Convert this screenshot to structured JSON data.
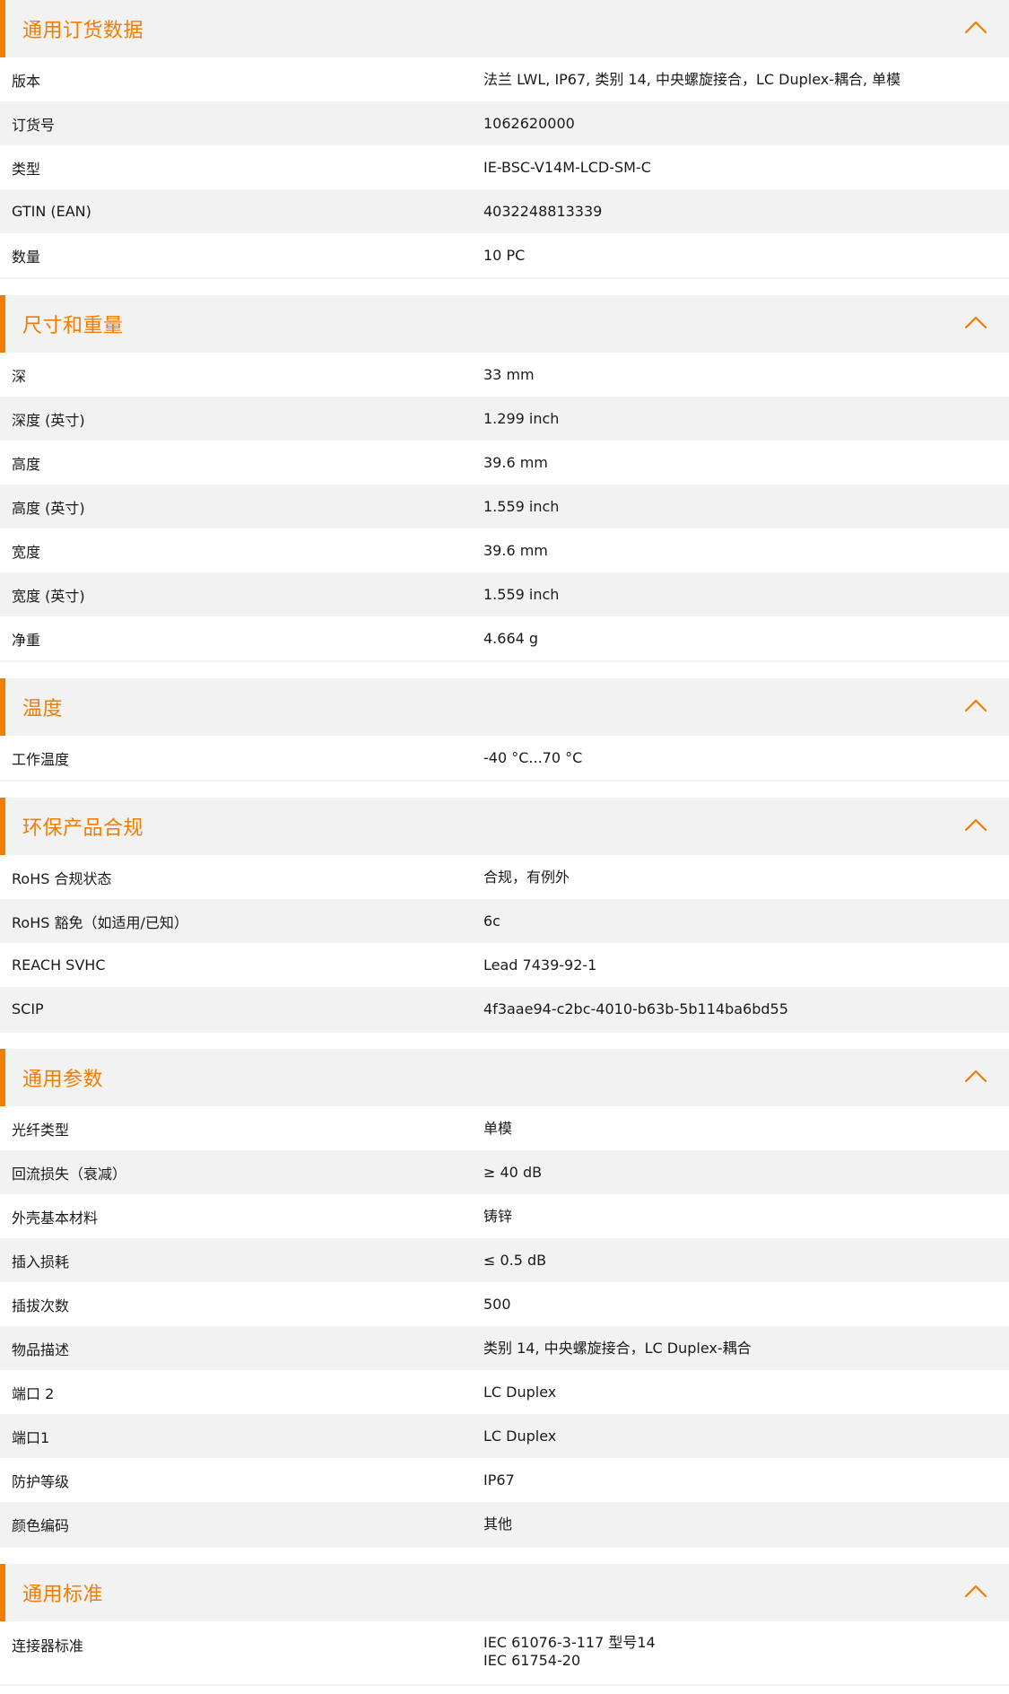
{
  "accent_color": "#f07d00",
  "header_bg": "#f2f2f2",
  "sections": [
    {
      "title": "通用订货数据",
      "icon": "chevron-up-icon",
      "rows": [
        {
          "label": "版本",
          "value": "法兰 LWL, IP67, 类别 14, 中央螺旋接合，LC Duplex-耦合, 单模"
        },
        {
          "label": "订货号",
          "value": "1062620000"
        },
        {
          "label": "类型",
          "value": "IE-BSC-V14M-LCD-SM-C"
        },
        {
          "label": "GTIN (EAN)",
          "value": "4032248813339"
        },
        {
          "label": "数量",
          "value": "10  PC"
        }
      ]
    },
    {
      "title": "尺寸和重量",
      "icon": "chevron-up-icon",
      "rows": [
        {
          "label": "深",
          "value": "33  mm"
        },
        {
          "label": "深度 (英寸)",
          "value": "1.299  inch"
        },
        {
          "label": "高度",
          "value": "39.6  mm"
        },
        {
          "label": "高度 (英寸)",
          "value": "1.559  inch"
        },
        {
          "label": "宽度",
          "value": "39.6  mm"
        },
        {
          "label": "宽度 (英寸)",
          "value": "1.559  inch"
        },
        {
          "label": "净重",
          "value": "4.664  g"
        }
      ]
    },
    {
      "title": "温度",
      "icon": "chevron-up-icon",
      "rows": [
        {
          "label": "工作温度",
          "value": "-40 °C...70 °C"
        }
      ]
    },
    {
      "title": "环保产品合规",
      "icon": "chevron-up-icon",
      "rows": [
        {
          "label": "RoHS 合规状态",
          "value": "合规，有例外"
        },
        {
          "label": "RoHS 豁免（如适用/已知）",
          "value": "6c"
        },
        {
          "label": "REACH SVHC",
          "value": "Lead 7439-92-1"
        },
        {
          "label": "SCIP",
          "value": "4f3aae94-c2bc-4010-b63b-5b114ba6bd55"
        }
      ]
    },
    {
      "title": "通用参数",
      "icon": "chevron-up-icon",
      "rows": [
        {
          "label": "光纤类型",
          "value": "单模"
        },
        {
          "label": "回流损失（衰减）",
          "value": "≥ 40 dB"
        },
        {
          "label": "外壳基本材料",
          "value": "铸锌"
        },
        {
          "label": "插入损耗",
          "value": "≤ 0.5 dB"
        },
        {
          "label": "插拔次数",
          "value": "500"
        },
        {
          "label": "物品描述",
          "value": "类别 14, 中央螺旋接合，LC Duplex-耦合"
        },
        {
          "label": "端口 2",
          "value": "LC Duplex"
        },
        {
          "label": "端口1",
          "value": "LC Duplex"
        },
        {
          "label": "防护等级",
          "value": "IP67"
        },
        {
          "label": "颜色编码",
          "value": "其他"
        }
      ]
    },
    {
      "title": "通用标准",
      "icon": "chevron-up-icon",
      "rows": [
        {
          "label": "连接器标准",
          "value": "IEC 61076-3-117 型号14",
          "value2": "IEC 61754-20"
        }
      ]
    }
  ]
}
